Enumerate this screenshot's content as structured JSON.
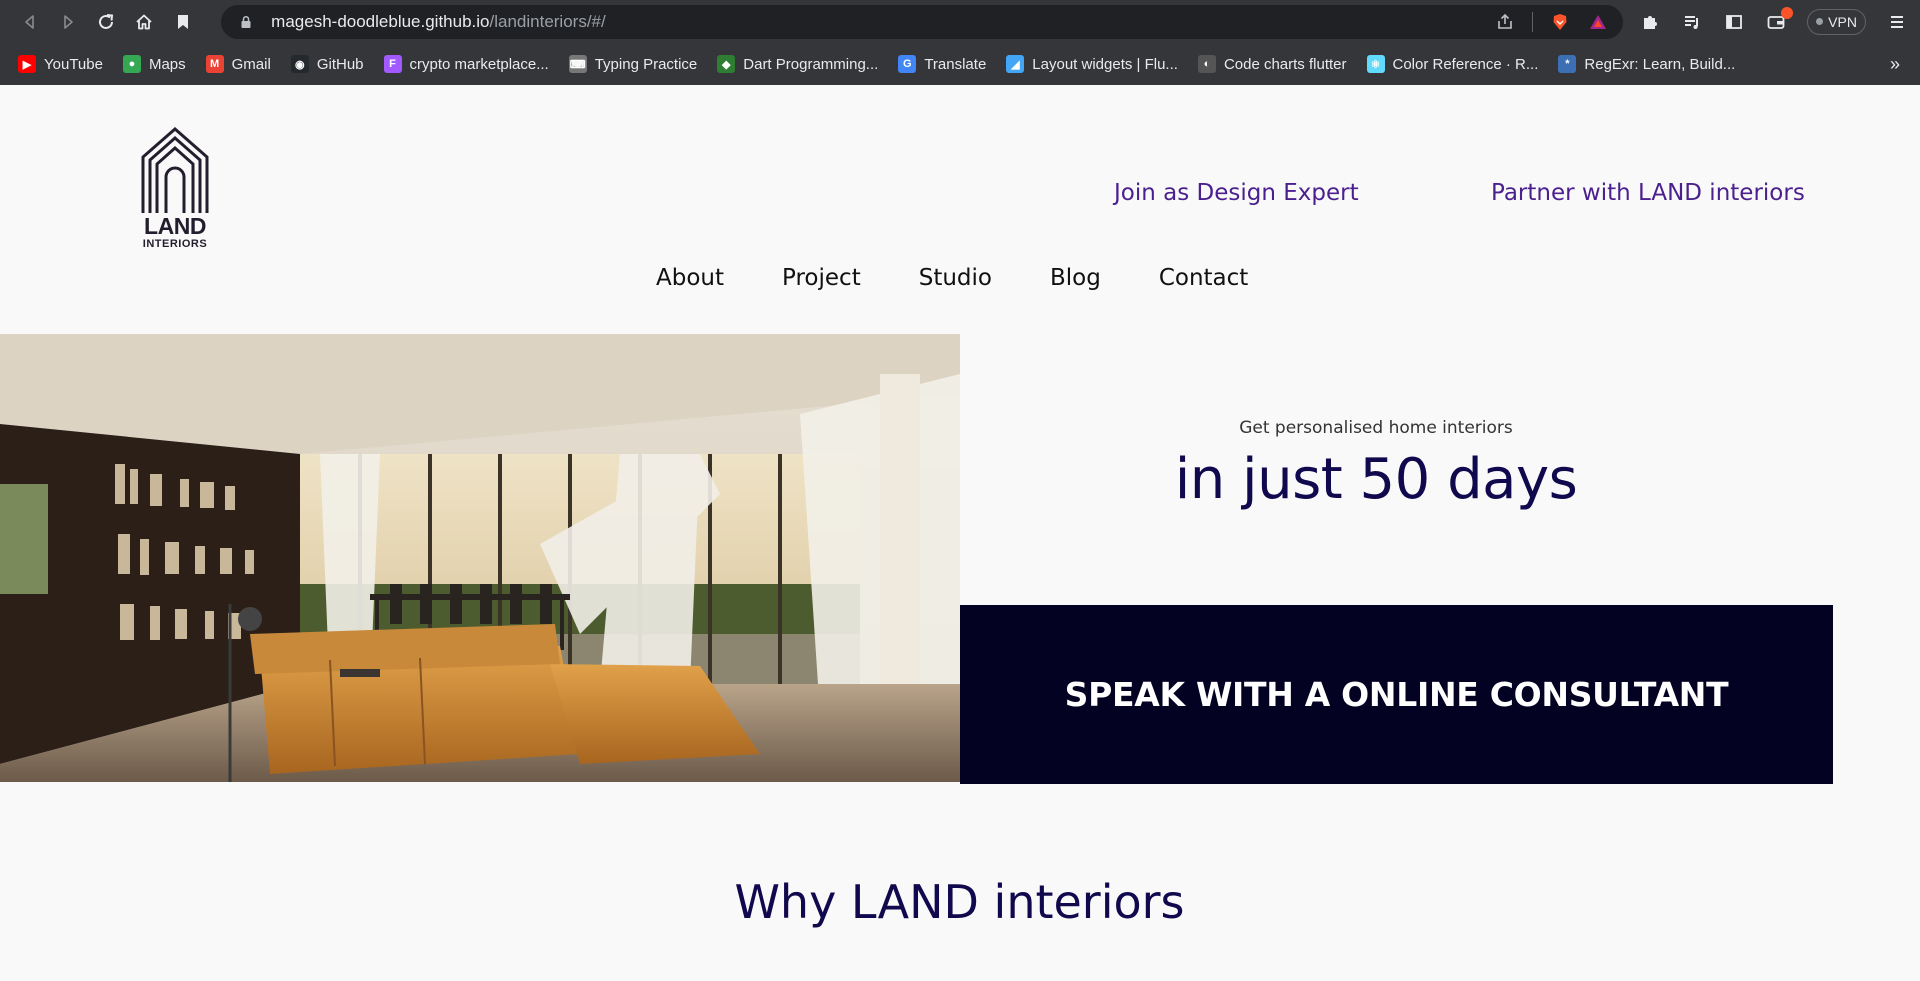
{
  "browser": {
    "url_host": "magesh-doodleblue.github.io",
    "url_path": "/landinteriors/#/",
    "vpn_label": "VPN",
    "bookmarks": [
      {
        "label": "YouTube",
        "color": "#ff0000",
        "glyph": "▶"
      },
      {
        "label": "Maps",
        "color": "#34a853",
        "glyph": "●"
      },
      {
        "label": "Gmail",
        "color": "#ea4335",
        "glyph": "M"
      },
      {
        "label": "GitHub",
        "color": "#24292e",
        "glyph": "◉"
      },
      {
        "label": "crypto marketplace...",
        "color": "#a259ff",
        "glyph": "F"
      },
      {
        "label": "Typing Practice",
        "color": "#777777",
        "glyph": "⌨"
      },
      {
        "label": "Dart Programming...",
        "color": "#2e7d32",
        "glyph": "◆"
      },
      {
        "label": "Translate",
        "color": "#4285f4",
        "glyph": "G"
      },
      {
        "label": "Layout widgets | Flu...",
        "color": "#42a5f5",
        "glyph": "◢"
      },
      {
        "label": "Code charts flutter",
        "color": "#555555",
        "glyph": "◐"
      },
      {
        "label": "Color Reference · R...",
        "color": "#61dafb",
        "glyph": "⚛"
      },
      {
        "label": "RegExr: Learn, Build...",
        "color": "#3d6fb4",
        "glyph": "*"
      }
    ],
    "more_bookmarks": "»"
  },
  "site": {
    "logo_word": "LAND",
    "logo_sub": "INTERIORS",
    "top_links": [
      "Join as Design Expert",
      "Partner with LAND interiors"
    ],
    "nav": [
      "About",
      "Project",
      "Studio",
      "Blog",
      "Contact"
    ],
    "hero": {
      "subtitle": "Get personalised home interiors",
      "title": "in just 50 days",
      "cta": "SPEAK WITH A ONLINE CONSULTANT"
    },
    "section_title": "Why LAND interiors"
  },
  "colors": {
    "accent_purple": "#4a1f8e",
    "navy": "#11094d",
    "cta_bg": "#030223"
  }
}
